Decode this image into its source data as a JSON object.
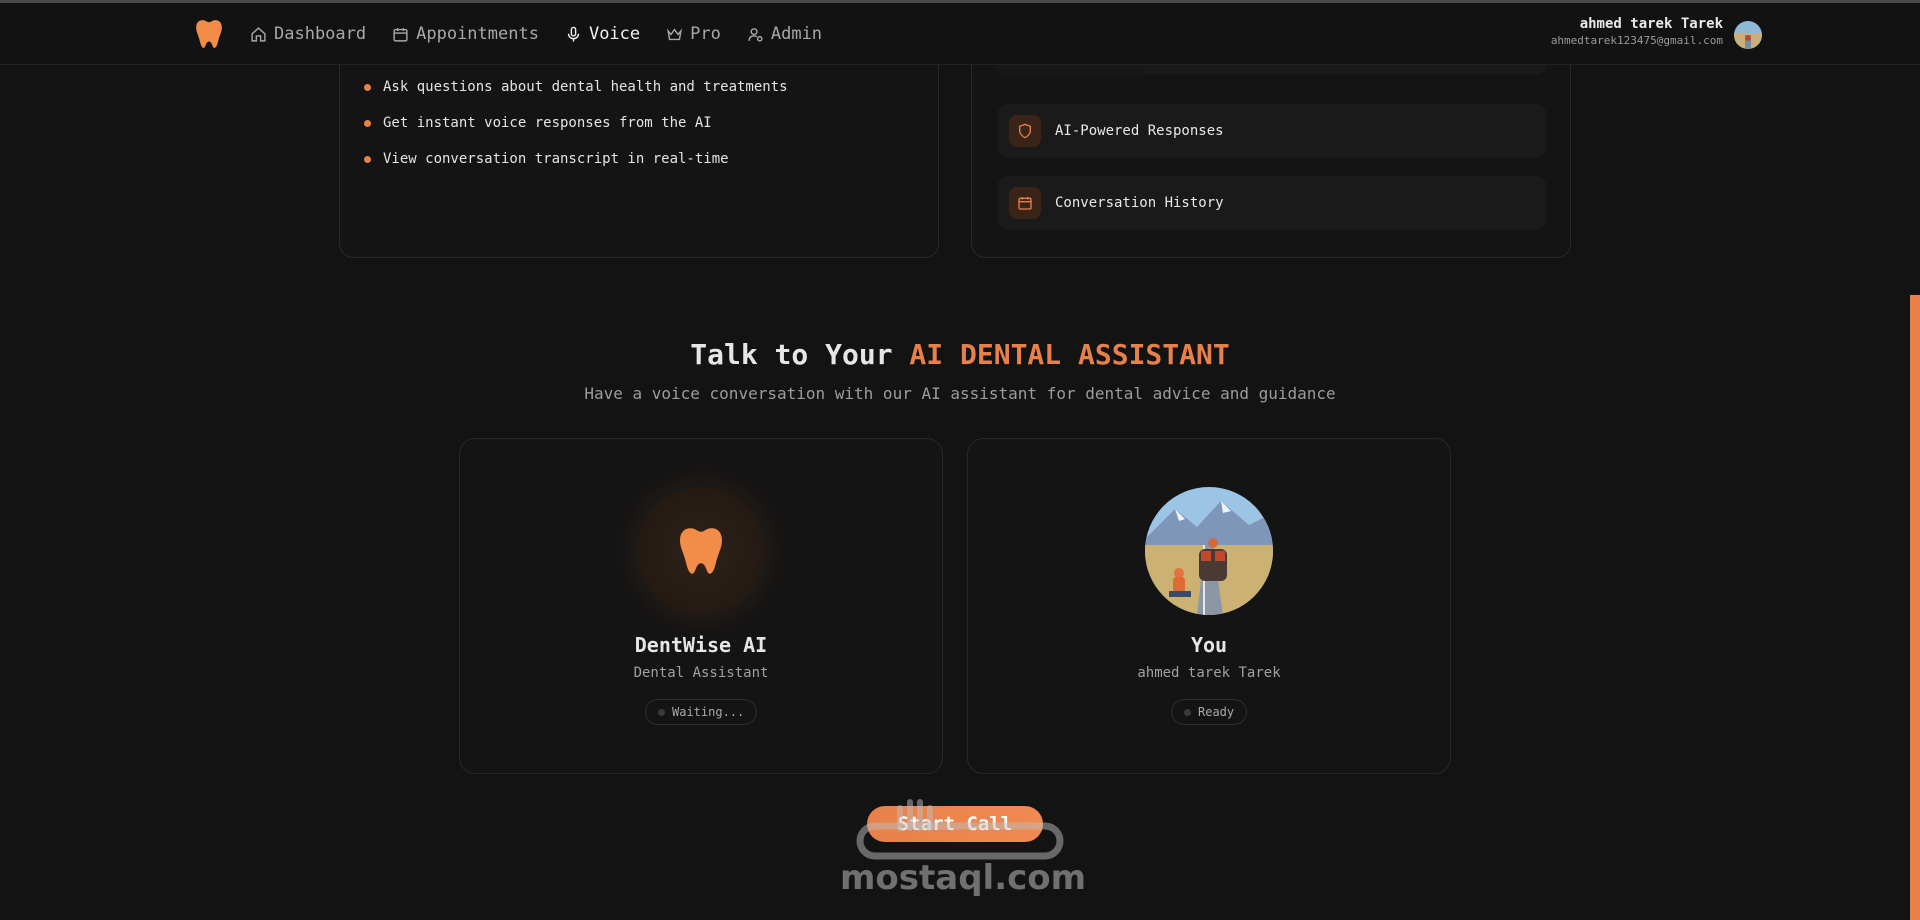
{
  "nav": {
    "items": [
      {
        "label": "Dashboard",
        "icon": "home-icon"
      },
      {
        "label": "Appointments",
        "icon": "calendar-icon"
      },
      {
        "label": "Voice",
        "icon": "microphone-icon",
        "active": true
      },
      {
        "label": "Pro",
        "icon": "crown-icon"
      },
      {
        "label": "Admin",
        "icon": "user-cog-icon"
      }
    ],
    "user": {
      "name": "ahmed tarek Tarek",
      "email": "ahmedtarek123475@gmail.com"
    }
  },
  "info_card": {
    "bullets": [
      "Ask questions about dental health and treatments",
      "Get instant voice responses from the AI",
      "View conversation transcript in real-time"
    ]
  },
  "features_card": {
    "items": [
      {
        "label": "AI-Powered Responses",
        "icon": "shield-icon"
      },
      {
        "label": "Conversation History",
        "icon": "calendar-icon"
      }
    ]
  },
  "hero": {
    "title_prefix": "Talk to Your",
    "title_accent": "AI DENTAL ASSISTANT",
    "subtitle": "Have a voice conversation with our AI assistant for dental advice and guidance"
  },
  "assistant": {
    "name": "DentWise AI",
    "role": "Dental Assistant",
    "status": "Waiting..."
  },
  "user_card": {
    "name": "You",
    "role": "ahmed tarek Tarek",
    "status": "Ready"
  },
  "start_call": "Start Call",
  "watermark": "mostaql.com",
  "colors": {
    "accent": "#e8804a",
    "background": "#131313"
  }
}
